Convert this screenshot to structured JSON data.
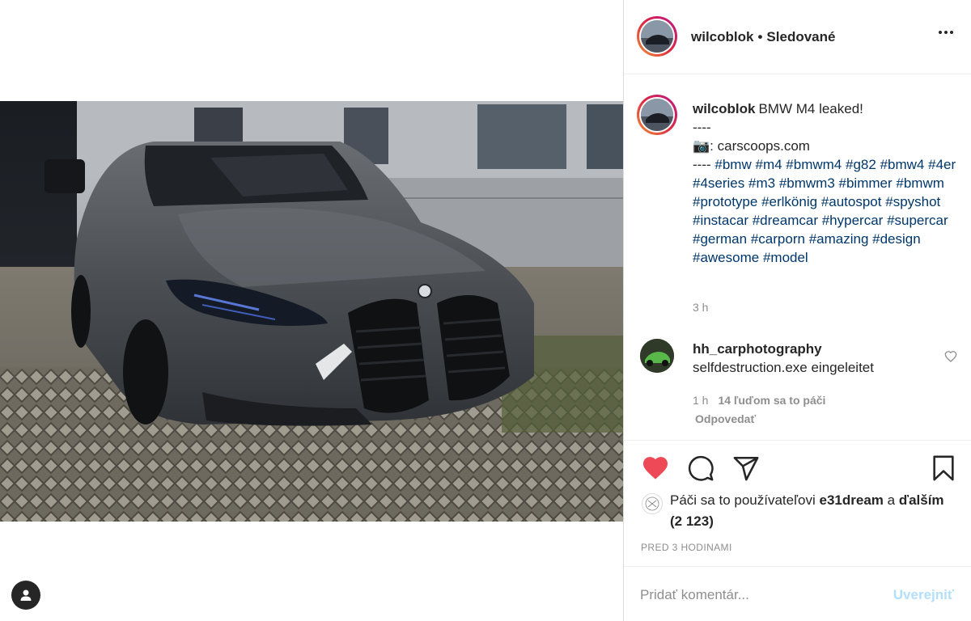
{
  "post": {
    "photo_alt": "BMW M4",
    "icons": {
      "user": "user-icon",
      "more": "more-options-icon"
    }
  },
  "header": {
    "username": "wilcoblok",
    "separator": "•",
    "follow_status": "Sledované"
  },
  "caption": {
    "username": "wilcoblok",
    "line1": "BMW M4 leaked!",
    "line2": "----",
    "camera_emoji": "📷",
    "source": ": carscoops.com",
    "dashes": "----",
    "hashtags": [
      "#bmw",
      "#m4",
      "#bmwm4",
      "#g82",
      "#bmw4",
      "#4er",
      "#4series",
      "#m3",
      "#bmwm3",
      "#bimmer",
      "#bmwm",
      "#prototype",
      "#erlkönig",
      "#autospot",
      "#spyshot",
      "#instacar",
      "#dreamcar",
      "#hypercar",
      "#supercar",
      "#german",
      "#carporn",
      "#amazing",
      "#design",
      "#awesome",
      "#model"
    ],
    "time": "3 h"
  },
  "comment": {
    "username": "hh_carphotography",
    "text": "selfdestruction.exe eingeleitet",
    "time": "1 h",
    "likes": "14 ľuďom sa to páči",
    "reply": "Odpovedať"
  },
  "actions": {
    "like_color": "#ed4956",
    "icons": [
      "heart-icon",
      "comment-icon",
      "share-icon",
      "bookmark-icon"
    ]
  },
  "likes": {
    "prefix": "Páči sa to používateľovi",
    "user": "e31dream",
    "connector": "a",
    "others": "ďalším (2 123)"
  },
  "post_time": "PRED 3 HODINAMI",
  "comment_box": {
    "placeholder": "Pridať komentár...",
    "publish": "Uverejniť"
  },
  "colors": {
    "hashtag": "#00376b",
    "secondary_text": "#8e8e8e",
    "publish_disabled": "#b2dffc"
  }
}
